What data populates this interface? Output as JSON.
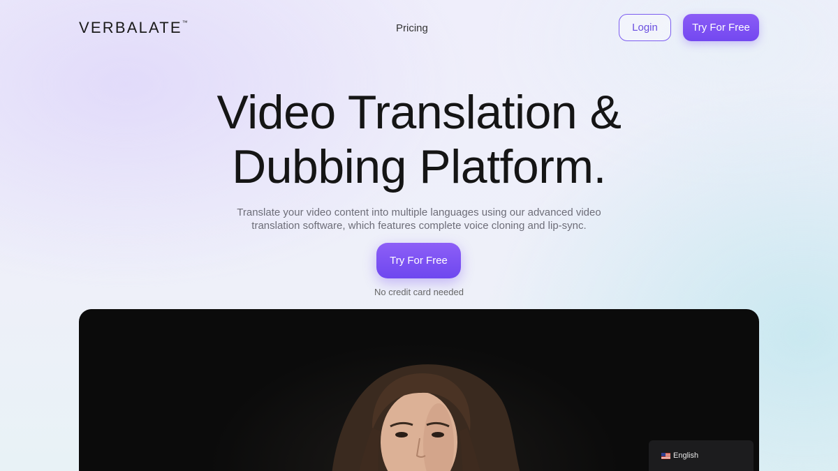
{
  "brand": {
    "name": "VERBALATE",
    "tm": "™"
  },
  "nav": {
    "pricing": "Pricing"
  },
  "header_buttons": {
    "login": "Login",
    "try": "Try For Free"
  },
  "hero": {
    "title_line1": "Video Translation &",
    "title_line2": "Dubbing Platform.",
    "subtitle_line1": "Translate your video content into multiple languages using our advanced video",
    "subtitle_line2": "translation software, which features complete voice cloning and lip-sync.",
    "cta": "Try For Free",
    "note": "No credit card needed"
  },
  "language_selector": {
    "selected": "English",
    "flag_icon": "us-flag-icon"
  },
  "colors": {
    "accent": "#7c5cf0",
    "dark": "#0b0b0b"
  }
}
